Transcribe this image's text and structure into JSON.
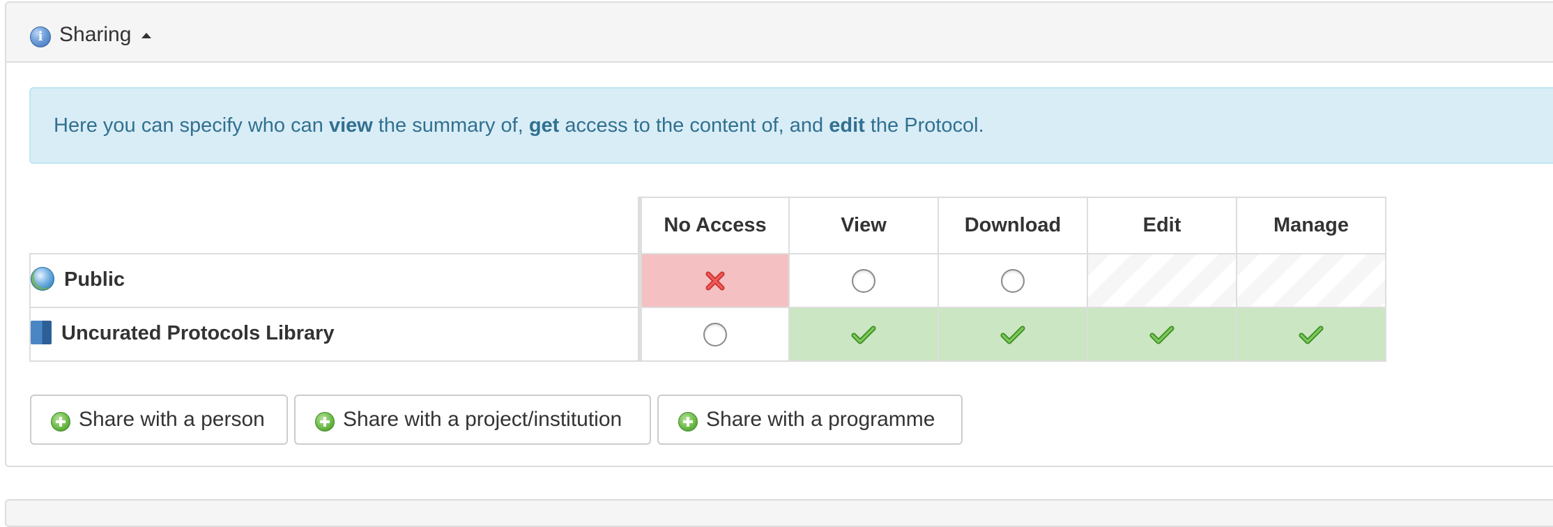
{
  "panel": {
    "title": "Sharing",
    "info_icon_glyph": "i",
    "icons": {
      "info": "info-icon",
      "toggle": "caret-up-icon"
    }
  },
  "alert": {
    "text_1": "Here you can specify who can ",
    "bold_1": "view",
    "text_2": " the summary of, ",
    "bold_2": "get",
    "text_3": " access to the content of, and ",
    "bold_3": "edit",
    "text_4": " the Protocol."
  },
  "permissions": {
    "columns": [
      "No Access",
      "View",
      "Download",
      "Edit",
      "Manage"
    ],
    "rows": [
      {
        "name": "Public",
        "icon": "globe-icon",
        "cells": [
          "denied",
          "radio",
          "radio",
          "disabled",
          "disabled"
        ]
      },
      {
        "name": "Uncurated Protocols Library",
        "icon": "library-icon",
        "cells": [
          "radio",
          "granted",
          "granted",
          "granted",
          "granted"
        ]
      }
    ]
  },
  "buttons": {
    "share_person": "Share with a person",
    "share_project": "Share with a project/institution",
    "share_programme": "Share with a programme",
    "icon": "plus-icon"
  },
  "colors": {
    "alert_bg": "#d9edf7",
    "alert_text": "#31708f",
    "denied_bg": "#f4c0c2",
    "granted_bg": "#cbe6c2",
    "check_green": "#5cae3a",
    "x_red": "#d83a3a"
  }
}
